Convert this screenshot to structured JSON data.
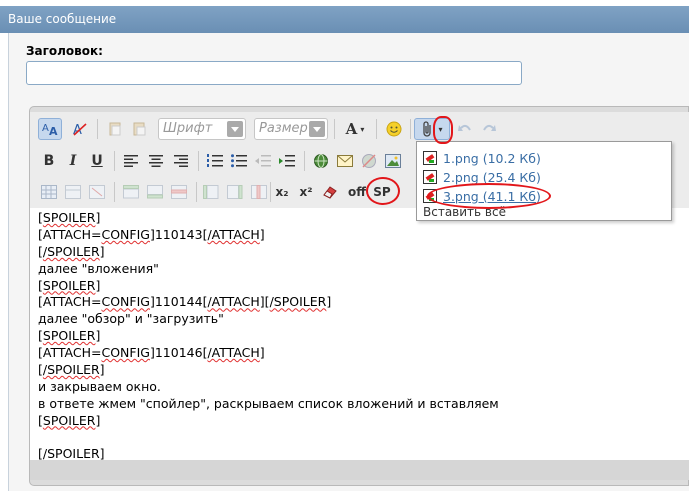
{
  "window": {
    "title": "Ваше сообщение"
  },
  "form": {
    "title_label": "Заголовок:",
    "title_value": ""
  },
  "toolbar": {
    "font_placeholder": "Шрифт",
    "size_placeholder": "Размер",
    "bold": "B",
    "italic": "I",
    "underline": "U",
    "text_color": "A",
    "sub": "x₂",
    "sup": "x²",
    "off": "off",
    "spoiler": "SP"
  },
  "attachments": {
    "items": [
      "1.png (10.2 Кб)",
      "2.png (25.4 Кб)",
      "3.png (41.1 Кб)"
    ],
    "insert_all": "Вставить всё"
  },
  "content": {
    "lines": [
      "[SPOILER]",
      "[ATTACH=CONFIG]110143[/ATTACH]",
      "[/SPOILER]",
      "далее \"вложения\"",
      "[SPOILER]",
      "[ATTACH=CONFIG]110144[/ATTACH][/SPOILER]",
      "далее \"обзор\" и \"загрузить\"",
      "[SPOILER]",
      "[ATTACH=CONFIG]110146[/ATTACH]",
      "[/SPOILER]",
      "и закрываем окно.",
      "в ответе жмем \"спойлер\", раскрываем список вложений и вставляем",
      "[SPOILER]",
      "",
      "[/SPOILER]"
    ]
  }
}
